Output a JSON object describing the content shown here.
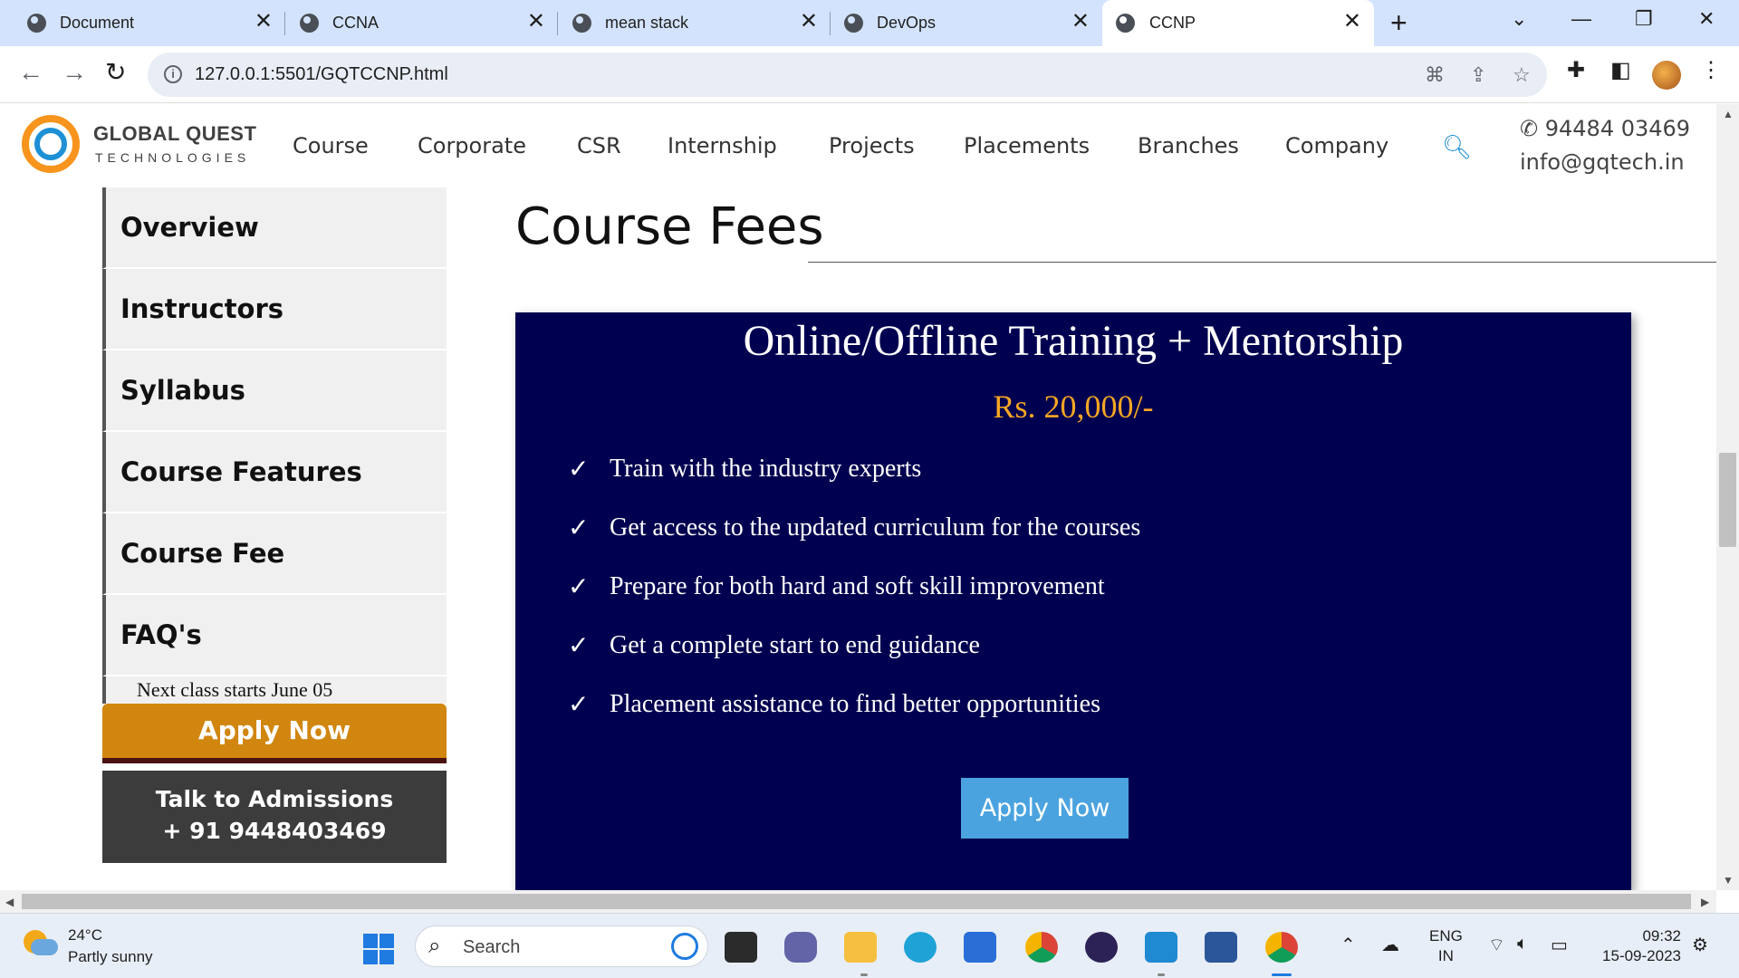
{
  "browser": {
    "tabs": [
      {
        "title": "Document"
      },
      {
        "title": "CCNA"
      },
      {
        "title": "mean stack"
      },
      {
        "title": "DevOps"
      },
      {
        "title": "CCNP"
      }
    ],
    "url": "127.0.0.1:5501/GQTCCNP.html"
  },
  "site": {
    "brand_name": "GLOBAL QUEST",
    "brand_sub": "TECHNOLOGIES",
    "nav": [
      "Course",
      "Corporate",
      "CSR",
      "Internship",
      "Projects",
      "Placements",
      "Branches",
      "Company"
    ],
    "phone": "✆ 94484 03469",
    "email": "info@gqtech.in"
  },
  "sidebar": {
    "items": [
      "Overview",
      "Instructors",
      "Syllabus",
      "Course Features",
      "Course Fee",
      "FAQ's"
    ],
    "next_class": "Next class starts June 05",
    "apply_label": "Apply Now",
    "talk_line1": "Talk to Admissions",
    "talk_line2": "+ 91 9448403469"
  },
  "main": {
    "section_title": "Course Fees",
    "card": {
      "title": "Online/Offline Training + Mentorship",
      "price": "Rs. 20,000/-",
      "features": [
        "Train with the industry experts",
        "Get access to the updated curriculum for the courses",
        "Prepare for both hard and soft skill improvement",
        "Get a complete start to end guidance",
        "Placement assistance to find better opportunities"
      ],
      "apply_label": "Apply Now"
    }
  },
  "taskbar": {
    "temperature": "24°C",
    "condition": "Partly sunny",
    "search_label": "Search",
    "lang_line1": "ENG",
    "lang_line2": "IN",
    "time": "09:32",
    "date": "15-09-2023"
  },
  "colors": {
    "card_bg": "#000050",
    "price": "#f5a623",
    "side_apply": "#d1860f",
    "card_apply": "#4aa3df",
    "talk_bg": "#3c3c3c"
  }
}
